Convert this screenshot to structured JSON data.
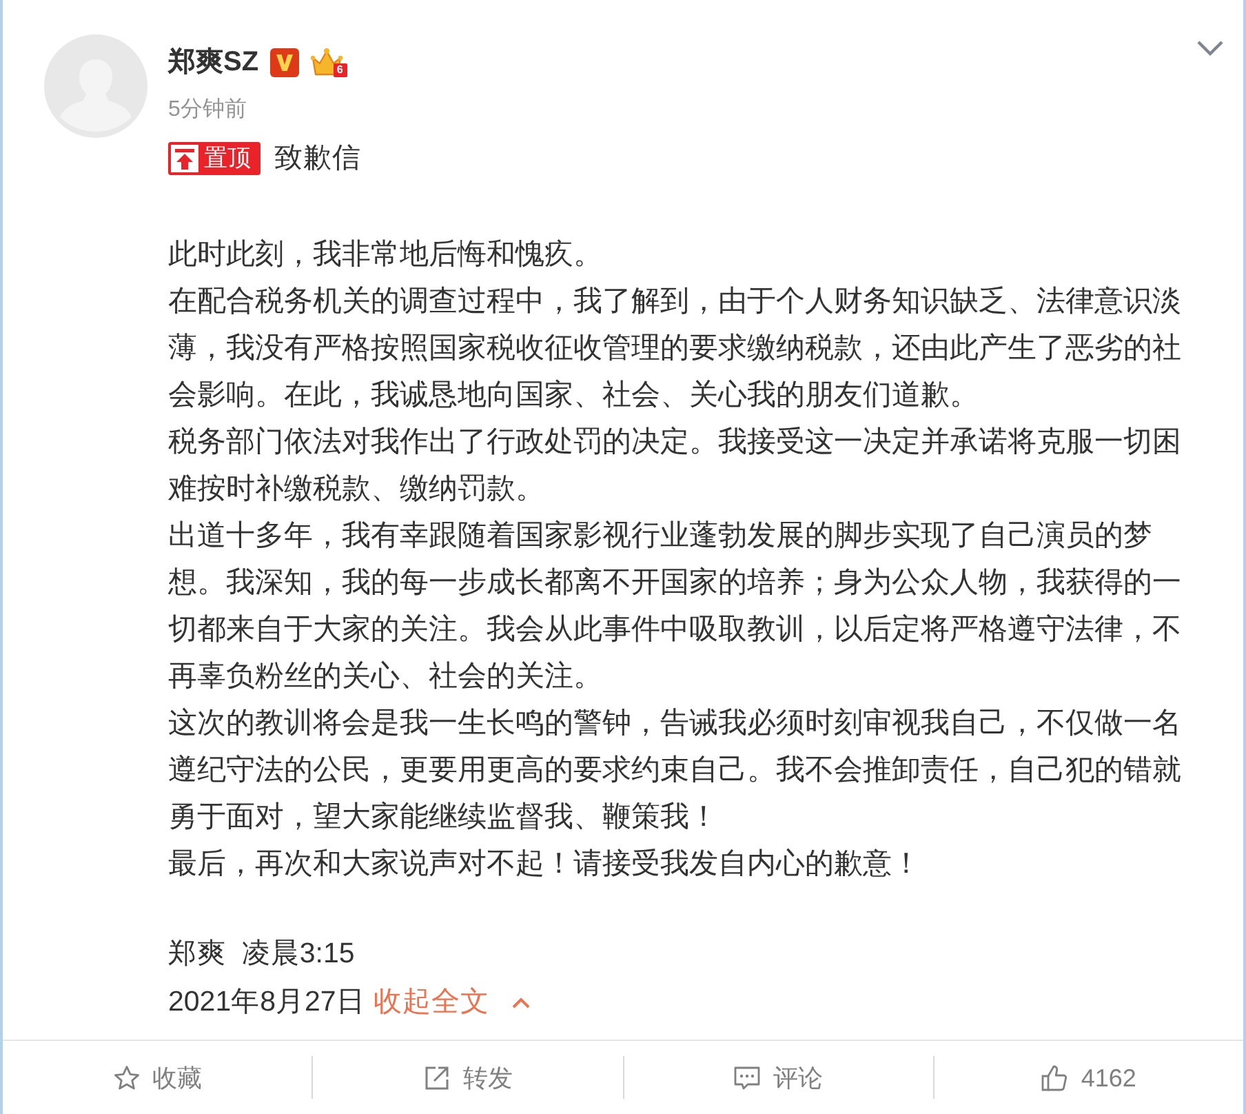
{
  "post": {
    "author": {
      "name": "郑爽SZ",
      "verified": true,
      "member_level": "6"
    },
    "time": "5分钟前",
    "pinned": true,
    "pin_label": "置顶",
    "title": "致歉信",
    "paragraphs": [
      "此时此刻，我非常地后悔和愧疚。",
      "在配合税务机关的调查过程中，我了解到，由于个人财务知识缺乏、法律意识淡薄，我没有严格按照国家税收征收管理的要求缴纳税款，还由此产生了恶劣的社会影响。在此，我诚恳地向国家、社会、关心我的朋友们道歉。",
      "税务部门依法对我作出了行政处罚的决定。我接受这一决定并承诺将克服一切困难按时补缴税款、缴纳罚款。",
      "出道十多年，我有幸跟随着国家影视行业蓬勃发展的脚步实现了自己演员的梦想。我深知，我的每一步成长都离不开国家的培养；身为公众人物，我获得的一切都来自于大家的关注。我会从此事件中吸取教训，以后定将严格遵守法律，不再辜负粉丝的关心、社会的关注。",
      "这次的教训将会是我一生长鸣的警钟，告诫我必须时刻审视我自己，不仅做一名遵纪守法的公民，更要用更高的要求约束自己。我不会推卸责任，自己犯的错就勇于面对，望大家能继续监督我、鞭策我！",
      "最后，再次和大家说声对不起！请接受我发自内心的歉意！"
    ],
    "signature": "郑爽  凌晨3:15",
    "date": "2021年8月27日",
    "collapse_link": "收起全文"
  },
  "actions": [
    {
      "kind": "favorite",
      "label": "收藏"
    },
    {
      "kind": "repost",
      "label": "转发"
    },
    {
      "kind": "comment",
      "label": "评论"
    },
    {
      "kind": "like",
      "label": "4162"
    }
  ]
}
